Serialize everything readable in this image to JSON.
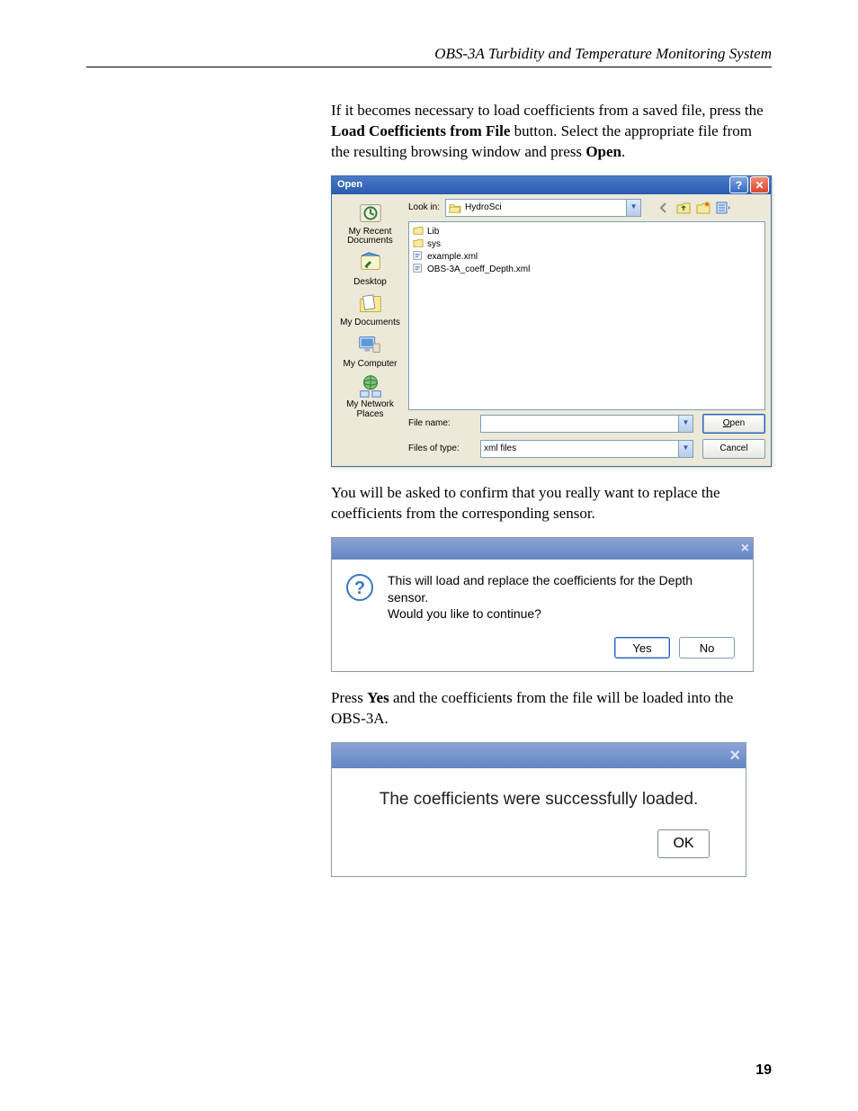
{
  "header": {
    "title": "OBS-3A Turbidity and Temperature Monitoring System"
  },
  "para1": {
    "pre": "If it becomes necessary to load coefficients from a saved file, press the ",
    "b1": "Load Coefficients from File",
    "mid": " button.  Select the appropriate file from the resulting browsing window and press ",
    "b2": "Open",
    "post": "."
  },
  "open_dialog": {
    "title": "Open",
    "lookin_label": "Look in:",
    "lookin_value": "HydroSci",
    "places": [
      {
        "label": "My Recent Documents",
        "icon": "recent"
      },
      {
        "label": "Desktop",
        "icon": "desktop"
      },
      {
        "label": "My Documents",
        "icon": "mydocs"
      },
      {
        "label": "My Computer",
        "icon": "computer"
      },
      {
        "label": "My Network Places",
        "icon": "network"
      }
    ],
    "nav_icons": [
      "back",
      "up",
      "newfolder",
      "views"
    ],
    "files": [
      {
        "name": "Lib",
        "type": "folder"
      },
      {
        "name": "sys",
        "type": "folder"
      },
      {
        "name": "example.xml",
        "type": "xml"
      },
      {
        "name": "OBS-3A_coeff_Depth.xml",
        "type": "xml"
      }
    ],
    "filename_label": "File name:",
    "filetype_label": "Files of type:",
    "filetype_value": "xml files",
    "open_btn": "Open",
    "cancel_btn": "Cancel"
  },
  "para2": "You will be asked to confirm that you really want to replace the coefficients from the corresponding sensor.",
  "confirm_dialog": {
    "line1": "This will load and replace the coefficients for the Depth sensor.",
    "line2": "Would you like to continue?",
    "yes": "Yes",
    "no": "No"
  },
  "para3": {
    "pre": "Press ",
    "b": "Yes",
    "post": " and the coefficients from the file will be loaded into the OBS-3A."
  },
  "success_dialog": {
    "text": "The coefficients were successfully loaded.",
    "ok": "OK"
  },
  "page_number": "19"
}
